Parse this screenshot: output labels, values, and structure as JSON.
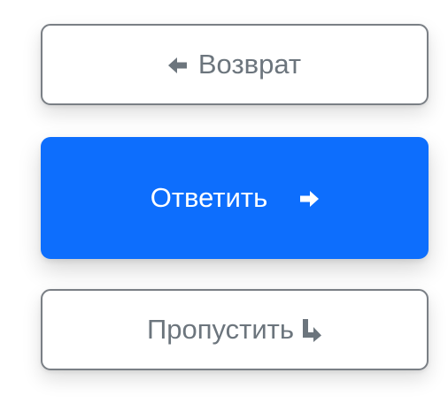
{
  "buttons": {
    "back": {
      "label": "Возврат",
      "icon": "arrow-left-icon"
    },
    "answer": {
      "label": "Ответить",
      "icon": "arrow-right-icon"
    },
    "skip": {
      "label": "Пропустить",
      "icon": "arrow-return-right-icon"
    }
  },
  "colors": {
    "primary": "#0d6efd",
    "secondary_text": "#6c757d",
    "secondary_border": "#7a7f85",
    "white": "#ffffff"
  }
}
